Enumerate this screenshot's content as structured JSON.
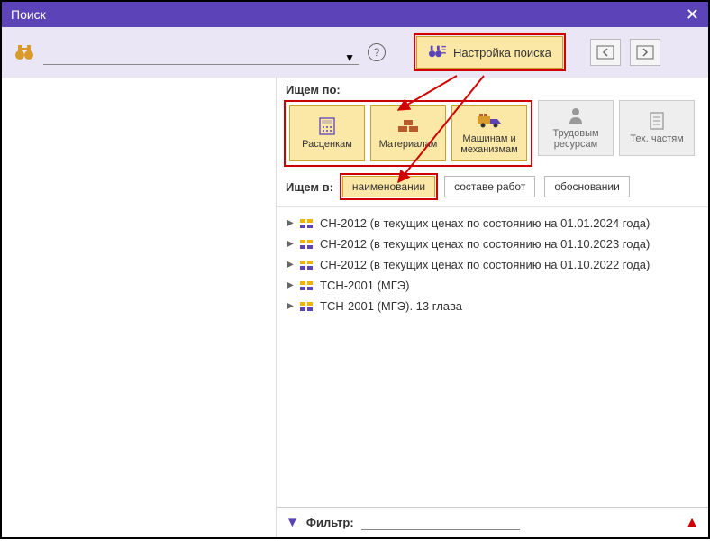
{
  "window": {
    "title": "Поиск"
  },
  "searchbar": {
    "value": "",
    "settings_label": "Настройка поиска"
  },
  "rightpane": {
    "search_by_label": "Ищем по:",
    "cards": [
      {
        "label": "Расценкам"
      },
      {
        "label": "Материалам"
      },
      {
        "label": "Машинам и механизмам"
      },
      {
        "label": "Трудовым ресурсам"
      },
      {
        "label": "Тех. частям"
      }
    ],
    "search_in_label": "Ищем в:",
    "pills": [
      {
        "label": "наименовании",
        "active": true
      },
      {
        "label": "составе работ",
        "active": false
      },
      {
        "label": "обосновании",
        "active": false
      }
    ],
    "tree": [
      {
        "label": "СН-2012 (в текущих ценах по состоянию на 01.01.2024 года)"
      },
      {
        "label": "СН-2012 (в текущих ценах по состоянию на 01.10.2023 года)"
      },
      {
        "label": "СН-2012 (в текущих ценах по состоянию на 01.10.2022 года)"
      },
      {
        "label": "ТСН-2001 (МГЭ)"
      },
      {
        "label": "ТСН-2001 (МГЭ). 13 глава"
      }
    ],
    "filter_label": "Фильтр:",
    "filter_value": ""
  }
}
